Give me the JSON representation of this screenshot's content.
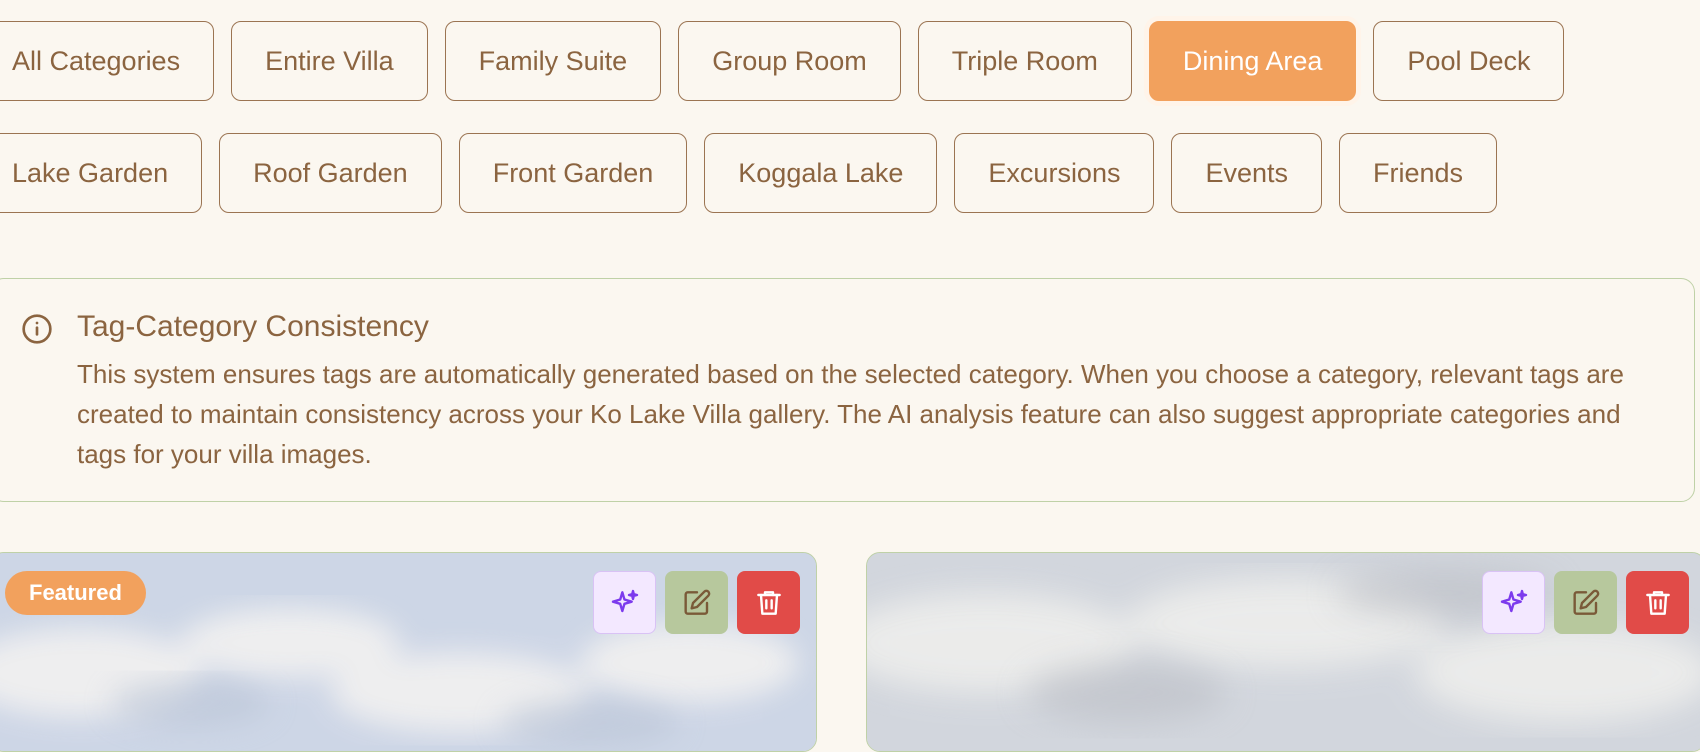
{
  "filters": {
    "row1": [
      {
        "label": "All Categories",
        "active": false
      },
      {
        "label": "Entire Villa",
        "active": false
      },
      {
        "label": "Family Suite",
        "active": false
      },
      {
        "label": "Group Room",
        "active": false
      },
      {
        "label": "Triple Room",
        "active": false
      },
      {
        "label": "Dining Area",
        "active": true
      },
      {
        "label": "Pool Deck",
        "active": false
      }
    ],
    "row2": [
      {
        "label": "Lake Garden",
        "active": false
      },
      {
        "label": "Roof Garden",
        "active": false
      },
      {
        "label": "Front Garden",
        "active": false
      },
      {
        "label": "Koggala Lake",
        "active": false
      },
      {
        "label": "Excursions",
        "active": false
      },
      {
        "label": "Events",
        "active": false
      },
      {
        "label": "Friends",
        "active": false
      }
    ]
  },
  "info": {
    "icon": "info-circle-icon",
    "title": "Tag-Category Consistency",
    "text": "This system ensures tags are automatically generated based on the selected category. When you choose a category, relevant tags are created to maintain consistency across your Ko Lake Villa gallery. The AI analysis feature can also suggest appropriate categories and tags for your villa images."
  },
  "cards": [
    {
      "badge": "Featured",
      "actions": [
        "sparkles-icon",
        "edit-icon",
        "trash-icon"
      ]
    },
    {
      "badge": "",
      "actions": [
        "sparkles-icon",
        "edit-icon",
        "trash-icon"
      ]
    }
  ],
  "colors": {
    "background": "#fbf7f0",
    "text": "#8b6440",
    "accent": "#f2a15d",
    "border_green": "#bfd1a7",
    "ai_button_bg": "#f3e8ff",
    "edit_button_bg": "#b7c89d",
    "delete_button_bg": "#e14b48"
  }
}
